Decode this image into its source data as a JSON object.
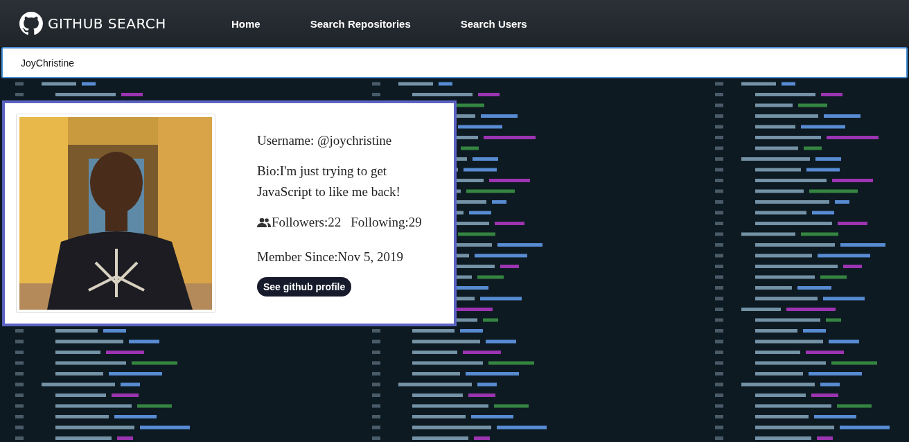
{
  "header": {
    "logo": "GITHUB SEARCH",
    "nav": [
      {
        "label": "Home"
      },
      {
        "label": "Search Repositories"
      },
      {
        "label": "Search Users"
      }
    ]
  },
  "search": {
    "value": "JoyChristine"
  },
  "profile": {
    "username": "Username: @joychristine",
    "bio": "Bio:I'm just trying to get JavaScript to like me back!",
    "followers": "Followers:22",
    "following": "Following:29",
    "member_since": "Member Since:Nov 5, 2019",
    "button": "See github profile"
  }
}
